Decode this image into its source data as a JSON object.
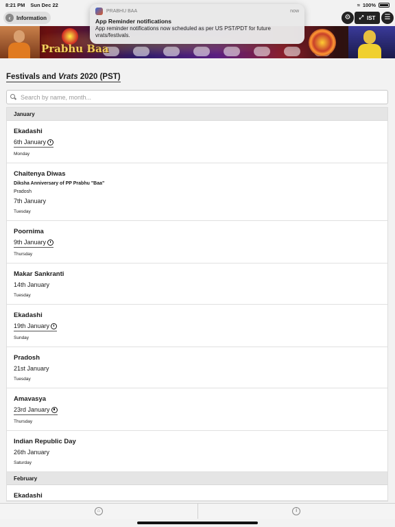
{
  "status_bar": {
    "time": "8:21 PM",
    "date": "Sun Dec 22",
    "battery": "100%"
  },
  "topbar": {
    "back_label": "Information",
    "timezone_label": "IST"
  },
  "banner": {
    "title": "Prabhu Baa"
  },
  "notification": {
    "app_name": "PRABHU BAA",
    "time": "now",
    "title": "App Reminder notifications",
    "body": "App reminder notifications now scheduled as per US PST/PDT for future vrats/festivals."
  },
  "main": {
    "title_prefix": "Festivals and ",
    "title_emphasis": "Vrats",
    "title_suffix": " 2020 (PST)",
    "search_placeholder": "Search by name, month..."
  },
  "list": [
    {
      "type": "divider",
      "label": "January"
    },
    {
      "type": "item",
      "name": "Ekadashi",
      "date": "6th January",
      "day": "Monday",
      "reminder": true
    },
    {
      "type": "item",
      "name": "Chaitenya Diwas",
      "subtitle": "Diksha Anniversary of PP Prabhu \"Baa\"",
      "note": "Pradosh",
      "date": "7th January",
      "day": "Tuesday",
      "reminder": false
    },
    {
      "type": "item",
      "name": "Poornima",
      "date": "9th January",
      "day": "Thursday",
      "reminder": true
    },
    {
      "type": "item",
      "name": "Makar Sankranti",
      "date": "14th January",
      "day": "Tuesday",
      "reminder": false
    },
    {
      "type": "item",
      "name": "Ekadashi",
      "date": "19th January",
      "day": "Sunday",
      "reminder": true
    },
    {
      "type": "item",
      "name": "Pradosh",
      "date": "21st January",
      "day": "Tuesday",
      "reminder": false
    },
    {
      "type": "item",
      "name": "Amavasya",
      "date": "23rd January",
      "day": "Thursday",
      "reminder": true
    },
    {
      "type": "item",
      "name": "Indian Republic Day",
      "date": "26th January",
      "day": "Saturday",
      "reminder": false
    },
    {
      "type": "divider",
      "label": "February"
    },
    {
      "type": "item",
      "name": "Ekadashi",
      "date": "",
      "day": "",
      "reminder": false
    }
  ],
  "tabbar": {
    "tabs": [
      {
        "icon": "home-icon"
      },
      {
        "icon": "info-icon"
      }
    ]
  }
}
